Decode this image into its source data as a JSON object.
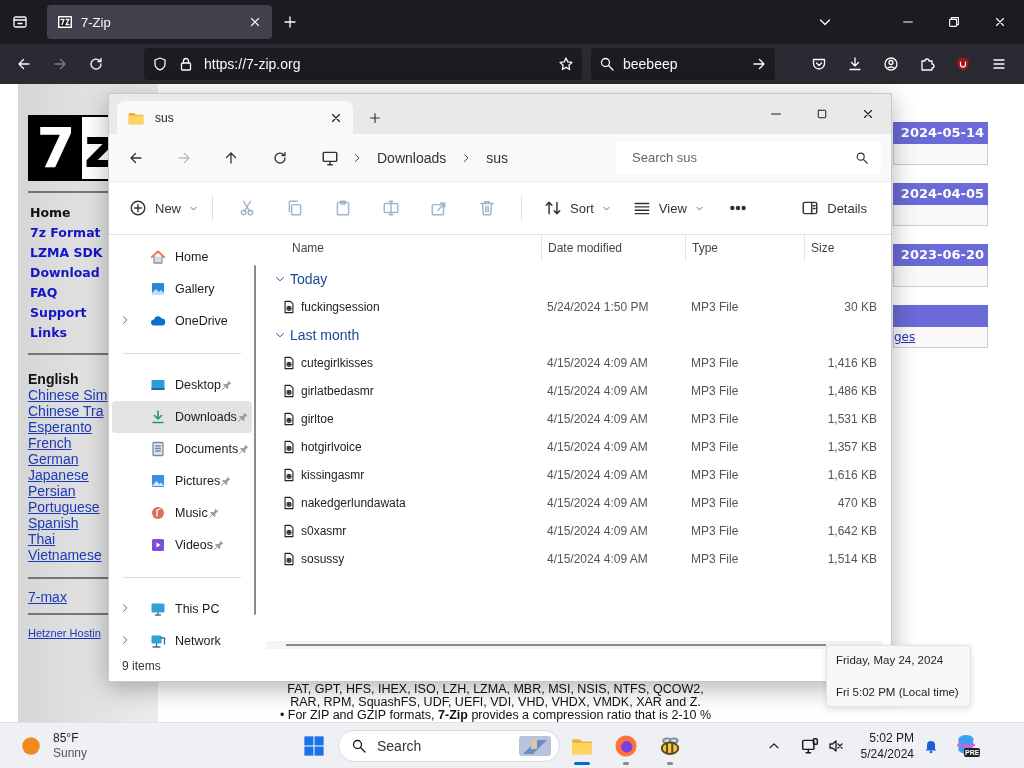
{
  "browser": {
    "tabs": [
      {
        "title": "7-Zip",
        "selected": true
      }
    ],
    "url": "https://7-zip.org",
    "search": {
      "value": "beebeep"
    }
  },
  "website": {
    "logo": {
      "digit": "7",
      "letter": "z"
    },
    "nav": [
      {
        "label": "Home",
        "selected": true
      },
      {
        "label": "7z Format",
        "selected": false
      },
      {
        "label": "LZMA SDK",
        "selected": false
      },
      {
        "label": "Download",
        "selected": false
      },
      {
        "label": "FAQ",
        "selected": false
      },
      {
        "label": "Support",
        "selected": false
      },
      {
        "label": "Links",
        "selected": false
      }
    ],
    "languages": [
      {
        "label": "English",
        "selected": true
      },
      {
        "label": "Chinese Sim",
        "selected": false
      },
      {
        "label": "Chinese Tra",
        "selected": false
      },
      {
        "label": "Esperanto",
        "selected": false
      },
      {
        "label": "French",
        "selected": false
      },
      {
        "label": "German",
        "selected": false
      },
      {
        "label": "Japanese",
        "selected": false
      },
      {
        "label": "Persian",
        "selected": false
      },
      {
        "label": "Portuguese",
        "selected": false
      },
      {
        "label": "Spanish",
        "selected": false
      },
      {
        "label": "Thai",
        "selected": false
      },
      {
        "label": "Vietnamese",
        "selected": false
      }
    ],
    "tools": [
      "7-max"
    ],
    "sponsor": "Hetzner Hostin",
    "news": [
      {
        "date": "2024-05-14"
      },
      {
        "date": "2024-04-05"
      },
      {
        "date": "2023-06-20"
      }
    ],
    "news_link": "ges",
    "body_lines": [
      "FAT, GPT, HFS, IHEX, ISO, LZH, LZMA, MBR, MSI, NSIS, NTFS, QCOW2,",
      "RAR, RPM, SquashFS, UDF, UEFI, VDI, VHD, VHDX, VMDK, XAR and Z.",
      "• For ZIP and GZIP formats, **7-Zip** provides a compression ratio that is 2-10 %"
    ]
  },
  "explorer": {
    "tabs": [
      {
        "title": "sus",
        "selected": true
      }
    ],
    "breadcrumb": [
      "Downloads",
      "sus"
    ],
    "search": {
      "placeholder": "Search sus"
    },
    "toolbar": [
      {
        "kind": "new",
        "label": "New",
        "disabled": false
      },
      {
        "kind": "cut",
        "disabled": true
      },
      {
        "kind": "copy",
        "disabled": true
      },
      {
        "kind": "paste",
        "disabled": true
      },
      {
        "kind": "rename",
        "disabled": true
      },
      {
        "kind": "share",
        "disabled": true
      },
      {
        "kind": "delete",
        "disabled": true
      },
      {
        "kind": "sort",
        "label": "Sort",
        "disabled": false
      },
      {
        "kind": "view",
        "label": "View",
        "disabled": false
      },
      {
        "kind": "more",
        "disabled": false
      },
      {
        "kind": "details",
        "label": "Details",
        "disabled": false
      }
    ],
    "nav_sections": [
      {
        "items": [
          {
            "kind": "home",
            "label": "Home",
            "expandable": false,
            "pinned": false,
            "selected": false
          },
          {
            "kind": "gallery",
            "label": "Gallery",
            "expandable": false,
            "pinned": false,
            "selected": false
          },
          {
            "kind": "cloud",
            "label": "OneDrive",
            "expandable": true,
            "pinned": false,
            "selected": false
          }
        ]
      },
      {
        "items": [
          {
            "kind": "desktop",
            "label": "Desktop",
            "expandable": false,
            "pinned": true,
            "selected": false
          },
          {
            "kind": "downloads",
            "label": "Downloads",
            "expandable": false,
            "pinned": true,
            "selected": true
          },
          {
            "kind": "documents",
            "label": "Documents",
            "expandable": false,
            "pinned": true,
            "selected": false
          },
          {
            "kind": "pictures",
            "label": "Pictures",
            "expandable": false,
            "pinned": true,
            "selected": false
          },
          {
            "kind": "music",
            "label": "Music",
            "expandable": false,
            "pinned": true,
            "selected": false
          },
          {
            "kind": "videos",
            "label": "Videos",
            "expandable": false,
            "pinned": true,
            "selected": false
          }
        ]
      },
      {
        "items": [
          {
            "kind": "thispc",
            "label": "This PC",
            "expandable": true,
            "pinned": false,
            "selected": false
          },
          {
            "kind": "network",
            "label": "Network",
            "expandable": true,
            "pinned": false,
            "selected": false
          }
        ]
      }
    ],
    "columns": [
      "Name",
      "Date modified",
      "Type",
      "Size"
    ],
    "groups": [
      {
        "label": "Today",
        "expanded": true,
        "files": [
          {
            "name": "fuckingsession",
            "date": "5/24/2024 1:50 PM",
            "type": "MP3 File",
            "size": "30 KB"
          }
        ]
      },
      {
        "label": "Last month",
        "expanded": true,
        "files": [
          {
            "name": "cutegirlkisses",
            "date": "4/15/2024 4:09 AM",
            "type": "MP3 File",
            "size": "1,416 KB"
          },
          {
            "name": "girlatbedasmr",
            "date": "4/15/2024 4:09 AM",
            "type": "MP3 File",
            "size": "1,486 KB"
          },
          {
            "name": "girltoe",
            "date": "4/15/2024 4:09 AM",
            "type": "MP3 File",
            "size": "1,531 KB"
          },
          {
            "name": "hotgirlvoice",
            "date": "4/15/2024 4:09 AM",
            "type": "MP3 File",
            "size": "1,357 KB"
          },
          {
            "name": "kissingasmr",
            "date": "4/15/2024 4:09 AM",
            "type": "MP3 File",
            "size": "1,616 KB"
          },
          {
            "name": "nakedgerlundawata",
            "date": "4/15/2024 4:09 AM",
            "type": "MP3 File",
            "size": "470 KB"
          },
          {
            "name": "s0xasmr",
            "date": "4/15/2024 4:09 AM",
            "type": "MP3 File",
            "size": "1,642 KB"
          },
          {
            "name": "sosussy",
            "date": "4/15/2024 4:09 AM",
            "type": "MP3 File",
            "size": "1,514 KB"
          }
        ]
      }
    ],
    "status": "9 items"
  },
  "tooltip": {
    "lines": [
      "Friday, May 24, 2024",
      "Fri 5:02 PM (Local time)"
    ]
  },
  "taskbar": {
    "weather": {
      "temperature": "85°F",
      "condition": "Sunny"
    },
    "search": {
      "placeholder": "Search"
    },
    "apps": [
      {
        "kind": "explorer",
        "active": true
      },
      {
        "kind": "firefox",
        "active": false
      },
      {
        "kind": "bee",
        "active": false
      }
    ],
    "clock": {
      "time": "5:02 PM",
      "date": "5/24/2024"
    },
    "copilot_badge": "PRE"
  }
}
